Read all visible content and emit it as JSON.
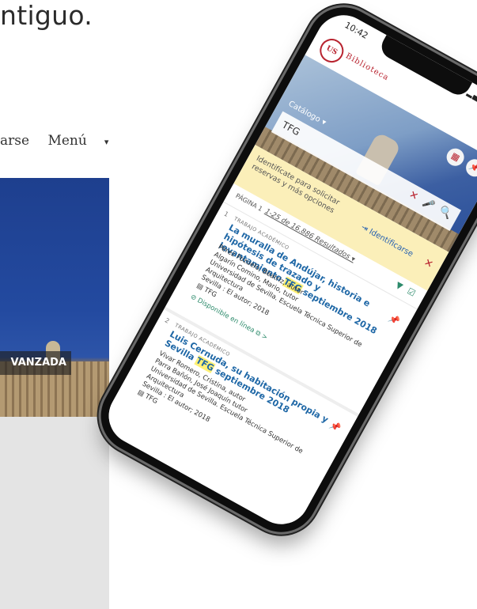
{
  "background": {
    "title_fragment": "ntiguo.",
    "nav": {
      "item1": "arse",
      "item2": "Menú",
      "caret": "▾"
    },
    "avanzada": "VANZADA"
  },
  "phone": {
    "status": {
      "time": "10:42",
      "icons": "▂▄▆ ⌔ ▭"
    },
    "app": {
      "logo": "US",
      "logo_text": "Biblioteca",
      "catalog_label": "Catálogo ▾",
      "search_value": "TFG",
      "buttons": {
        "qr": "▦",
        "pin": "📌",
        "clear": "✕",
        "mic": "🎤",
        "search": "🔍"
      }
    },
    "banner": {
      "message": "Identifícate para solicitar reservas y más opciones",
      "login": "⇥ Identificarse",
      "close": "✕"
    },
    "results_bar": {
      "page": "PÁGINA 1",
      "count": "1-25 de 16.886 Resultados ▾",
      "filter": "▼",
      "check": "☑"
    },
    "results": [
      {
        "num": "1",
        "type": "TRABAJO ACADÉMICO",
        "title_a": "La muralla de Andújar, historia e hipótesis de trazado y levantamiento ",
        "title_hl": "TFG",
        "title_b": " septiembre 2018",
        "authors": "Pérez Pozuelo, Beatriz, autor",
        "tutor1": "Algarín Comino, Mario, tutor",
        "institution": "Universidad de Sevilla. Escuela Técnica Superior de Arquitectura",
        "publisher": "Sevilla : El autor; 2018",
        "format": "▤ TFG",
        "availability": "⊘ Disponible en línea ⧉ >",
        "pin": "📌"
      },
      {
        "num": "2",
        "type": "TRABAJO ACADÉMICO",
        "title_a": "Luis Cernuda, su habitación propia y Sevilla ",
        "title_hl": "TFG",
        "title_b": " septiembre 2018",
        "authors": "Vivar Romero, Cristina, autor",
        "tutor1": "Parra Bañón, José Joaquín tutor",
        "institution": "Universidad de Sevilla. Escuela Técnica Superior de Arquitectura",
        "publisher": "Sevilla : El autor; 2018",
        "format": "▤ TFG",
        "pin": "📌"
      }
    ]
  }
}
